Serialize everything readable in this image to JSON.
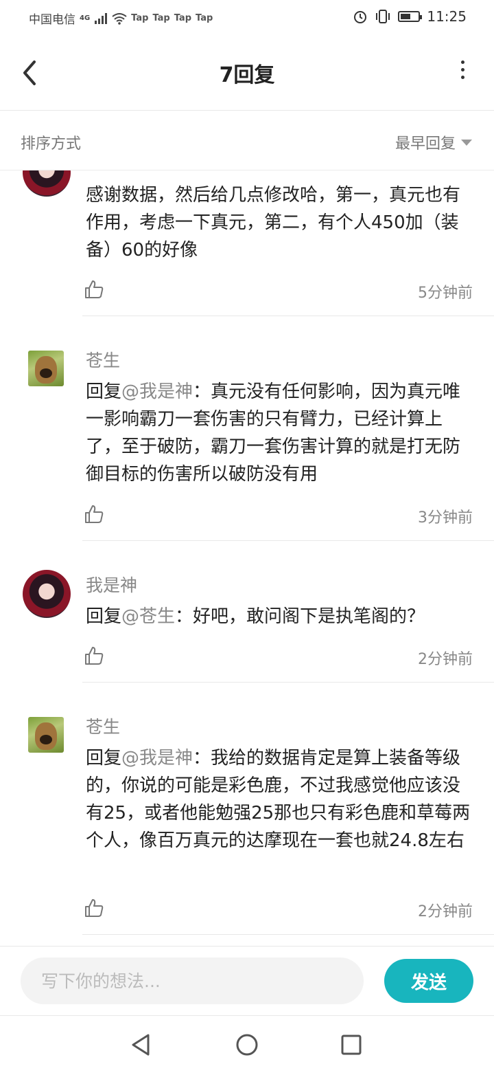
{
  "status_bar": {
    "carrier": "中国电信",
    "network": "4G",
    "notifications": [
      "Tap",
      "Tap",
      "Tap",
      "Tap"
    ],
    "time": "11:25",
    "battery_level": 0.5
  },
  "header": {
    "title": "7回复",
    "back_icon": "chevron-left-icon",
    "more_icon": "more-vertical-icon"
  },
  "sort": {
    "label": "排序方式",
    "selected": "最早回复"
  },
  "comments": [
    {
      "author": "",
      "avatar": "anime-avatar",
      "text": "感谢数据，然后给几点修改哈，第一，真元也有作用，考虑一下真元，第二，有个人450加（装备）60的好像",
      "time": "5分钟前"
    },
    {
      "author": "苍生",
      "avatar": "dog-avatar",
      "reply_prefix": "回复",
      "reply_to": "@我是神",
      "text": "：真元没有任何影响，因为真元唯一影响霸刀一套伤害的只有臂力，已经计算上了，至于破防，霸刀一套伤害计算的就是打无防御目标的伤害所以破防没有用",
      "time": "3分钟前"
    },
    {
      "author": "我是神",
      "avatar": "anime-avatar",
      "reply_prefix": "回复",
      "reply_to": "@苍生",
      "text": "：好吧，敢问阁下是执笔阁的？",
      "time": "2分钟前"
    },
    {
      "author": "苍生",
      "avatar": "dog-avatar",
      "reply_prefix": "回复",
      "reply_to": "@我是神",
      "text": "：我给的数据肯定是算上装备等级的，你说的可能是彩色鹿，不过我感觉他应该没有25，或者他能勉强25那也只有彩色鹿和草莓两个人，像百万真元的达摩现在一套也就24.8左右",
      "time": "2分钟前"
    }
  ],
  "composer": {
    "placeholder": "写下你的想法...",
    "send_label": "发送",
    "send_color": "#18b5be"
  },
  "nav": {
    "back_icon": "triangle-back-icon",
    "home_icon": "circle-home-icon",
    "recents_icon": "square-recents-icon"
  }
}
